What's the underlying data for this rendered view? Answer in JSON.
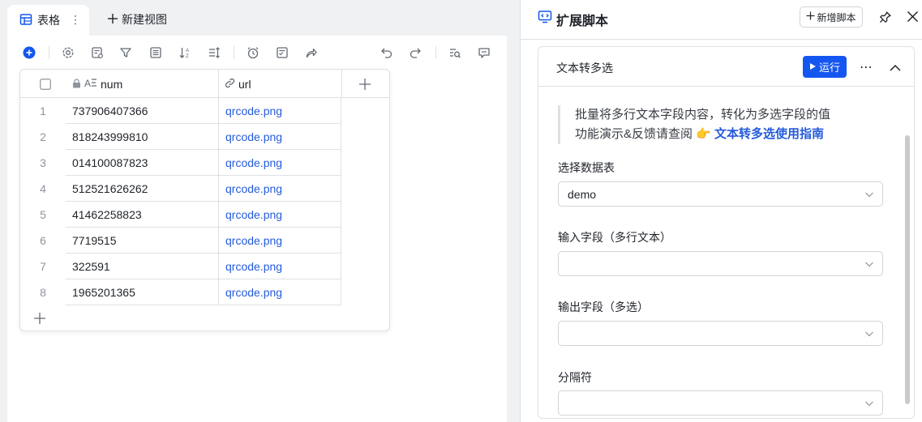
{
  "tabs": {
    "active_label": "表格",
    "new_view_label": "新建视图"
  },
  "grid": {
    "columns": [
      {
        "label": "num",
        "type": "text",
        "locked": true
      },
      {
        "label": "url",
        "type": "link"
      }
    ],
    "rows": [
      {
        "index": "1",
        "num": "737906407366",
        "url": "qrcode.png"
      },
      {
        "index": "2",
        "num": "818243999810",
        "url": "qrcode.png"
      },
      {
        "index": "3",
        "num": "014100087823",
        "url": "qrcode.png"
      },
      {
        "index": "4",
        "num": "512521626262",
        "url": "qrcode.png"
      },
      {
        "index": "5",
        "num": "41462258823",
        "url": "qrcode.png"
      },
      {
        "index": "6",
        "num": "7719515",
        "url": "qrcode.png"
      },
      {
        "index": "7",
        "num": "322591",
        "url": "qrcode.png"
      },
      {
        "index": "8",
        "num": "1965201365",
        "url": "qrcode.png"
      }
    ]
  },
  "panel": {
    "title": "扩展脚本",
    "add_script_label": "新增脚本",
    "card": {
      "title": "文本转多选",
      "run_label": "运行",
      "description_line1": "批量将多行文本字段内容，转化为多选字段的值",
      "description_line2": "功能演示&反馈请查阅",
      "description_emoji": "👉",
      "description_link": "文本转多选使用指南",
      "fields": [
        {
          "label": "选择数据表",
          "value": "demo"
        },
        {
          "label": "输入字段（多行文本）",
          "value": ""
        },
        {
          "label": "输出字段（多选）",
          "value": ""
        },
        {
          "label": "分隔符",
          "value": ""
        }
      ]
    }
  },
  "colors": {
    "accent": "#1456f0",
    "link": "#245bdb",
    "border": "#dee0e3"
  }
}
